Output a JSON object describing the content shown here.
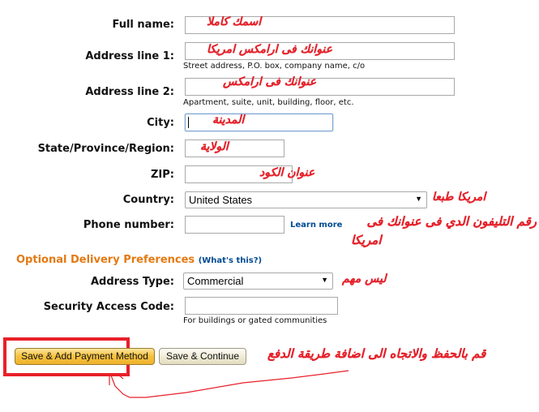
{
  "form": {
    "full_name": {
      "label": "Full name:",
      "value": "",
      "annotation": "اسمك كاملا"
    },
    "address_line1": {
      "label": "Address line 1:",
      "value": "",
      "hint": "Street address, P.O. box, company name, c/o",
      "annotation": "عنوانك فى ارامكس امريكا"
    },
    "address_line2": {
      "label": "Address line 2:",
      "value": "",
      "hint": "Apartment, suite, unit, building, floor, etc.",
      "annotation": "عنوانك فى ارامكس"
    },
    "city": {
      "label": "City:",
      "value": "",
      "annotation": "المدينة"
    },
    "state": {
      "label": "State/Province/Region:",
      "value": "",
      "annotation": "الولاية"
    },
    "zip": {
      "label": "ZIP:",
      "value": "",
      "annotation": "عنوان الكود"
    },
    "country": {
      "label": "Country:",
      "selected": "United States",
      "annotation": "امريكا طبعا"
    },
    "phone": {
      "label": "Phone number:",
      "value": "",
      "learn_more": "Learn more",
      "annotation_line1": "رقم التليفون الدي فى عنوانك فى",
      "annotation_line2": "امريكا"
    }
  },
  "optional": {
    "heading": "Optional Delivery Preferences",
    "whats_this": "(What's this?)",
    "address_type": {
      "label": "Address Type:",
      "selected": "Commercial",
      "annotation": "ليس مهم"
    },
    "security_code": {
      "label": "Security Access Code:",
      "value": "",
      "hint": "For buildings or gated communities"
    }
  },
  "buttons": {
    "save_add_payment": "Save & Add Payment Method",
    "save_continue": "Save & Continue",
    "annotation": "قم بالحفظ والاتجاه الى اضافة طريقة الدفع"
  },
  "colors": {
    "heading_orange": "#e47911",
    "link_blue": "#004b91",
    "annotation_red": "#e8202a"
  }
}
